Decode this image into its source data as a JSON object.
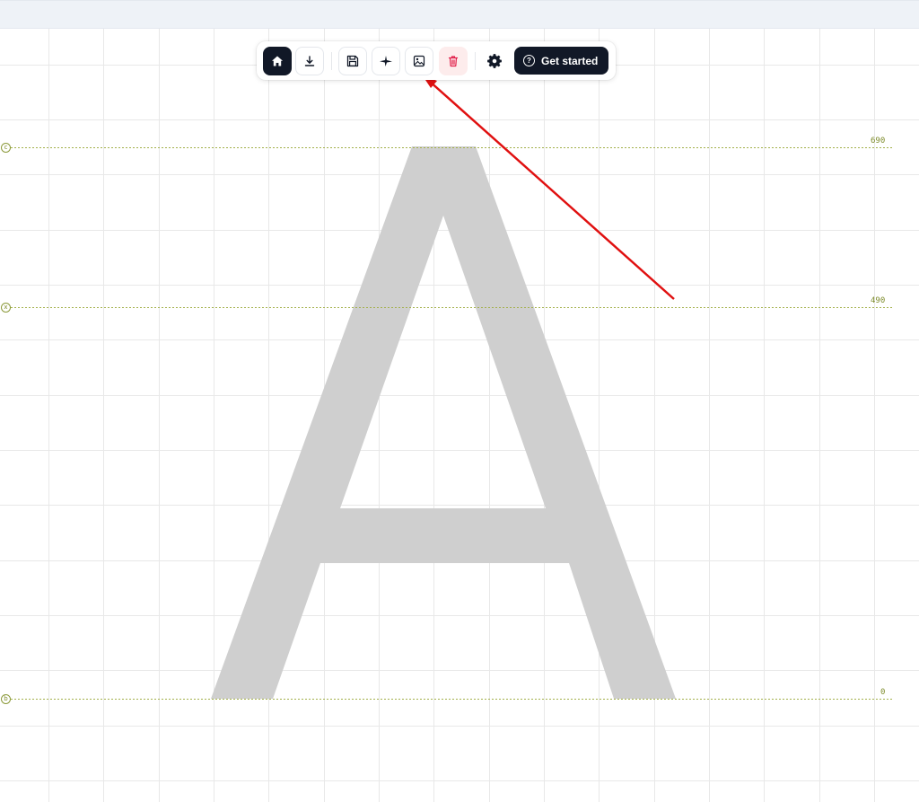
{
  "toolbar": {
    "buttons": [
      {
        "name": "home",
        "icon": "home-icon"
      },
      {
        "name": "download",
        "icon": "download-icon"
      },
      {
        "name": "save",
        "icon": "save-icon"
      },
      {
        "name": "sparkle",
        "icon": "sparkle-icon"
      },
      {
        "name": "image",
        "icon": "image-icon"
      },
      {
        "name": "delete",
        "icon": "trash-icon"
      },
      {
        "name": "settings",
        "icon": "gear-icon"
      }
    ],
    "cta_label": "Get started",
    "cta_icon": "help-circle-icon"
  },
  "glyph": {
    "character": "A",
    "fill": "#cfcfcf"
  },
  "metrics": [
    {
      "badge": "c",
      "value": "690"
    },
    {
      "badge": "x",
      "value": "490"
    },
    {
      "badge": "b",
      "value": "0"
    }
  ],
  "colors": {
    "accent": "#111827",
    "metric_line": "#a3b04a",
    "danger": "#e11d48",
    "annotation_arrow": "#e01010",
    "grid": "#e8e8e8"
  }
}
